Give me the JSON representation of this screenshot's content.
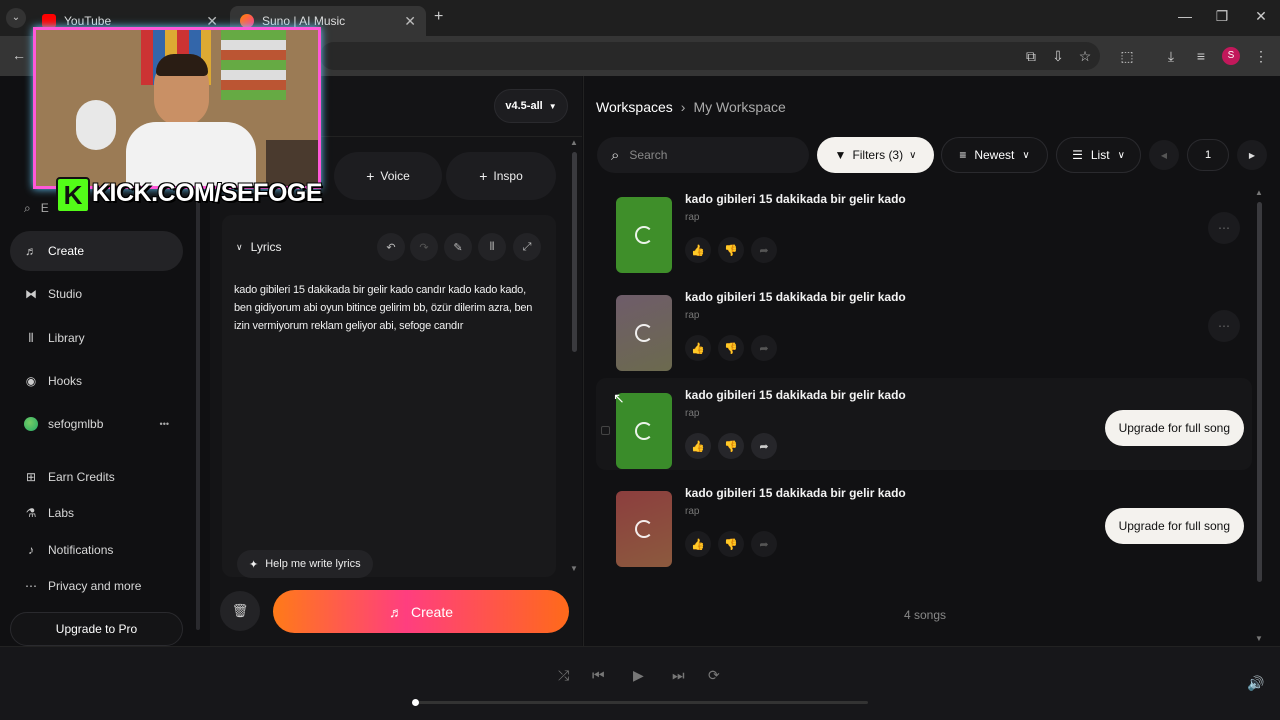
{
  "browser": {
    "tabs": [
      {
        "title": "YouTube",
        "close": "✕"
      },
      {
        "title": "Suno | AI Music",
        "close": "✕"
      }
    ],
    "new_tab": "+",
    "window_controls": [
      "—",
      "❐",
      "✕"
    ],
    "profile_initial": "S"
  },
  "overlay": {
    "badge_letter": "K",
    "stream_url": "KICK.COM/SEFOGE"
  },
  "sidebar": {
    "search_placeholder": "E",
    "items": [
      {
        "label": "Create",
        "icon": "music-note-icon",
        "active": true
      },
      {
        "label": "Studio",
        "icon": "studio-icon"
      },
      {
        "label": "Library",
        "icon": "library-icon"
      },
      {
        "label": "Hooks",
        "icon": "hooks-icon"
      },
      {
        "label": "sefogmlbb",
        "icon": "avatar-icon",
        "more": "•••"
      },
      {
        "label": "Earn Credits",
        "icon": "gift-icon"
      },
      {
        "label": "Labs",
        "icon": "flask-icon"
      },
      {
        "label": "Notifications",
        "icon": "bell-icon"
      },
      {
        "label": "Privacy and more",
        "icon": "more-icon"
      }
    ],
    "upgrade": "Upgrade to Pro"
  },
  "create": {
    "model": "v4.5-all",
    "voice": "Voice",
    "inspo": "Inspo",
    "lyrics_label": "Lyrics",
    "lyrics_text": "kado gibileri 15 dakikada bir gelir kado candır kado kado kado, ben gidiyorum abi oyun bitince gelirim bb, özür dilerim azra, ben izin vermiyorum reklam geliyor abi, sefoge candır",
    "help": "Help me write lyrics",
    "create_button": "Create"
  },
  "workspace": {
    "breadcrumb_root": "Workspaces",
    "breadcrumb_sep": "›",
    "breadcrumb_current": "My Workspace",
    "search_placeholder": "Search",
    "filters": "Filters (3)",
    "sort": "Newest",
    "view": "List",
    "page": "1",
    "count": "4 songs",
    "songs": [
      {
        "title": "kado gibileri 15 dakikada bir gelir kado",
        "tag": "rap",
        "color": "#3f8f2a",
        "upgrade": ""
      },
      {
        "title": "kado gibileri 15 dakikada bir gelir kado",
        "tag": "rap",
        "color": "#6e6060",
        "upgrade": ""
      },
      {
        "title": "kado gibileri 15 dakikada bir gelir kado",
        "tag": "rap",
        "color": "#3a8c2a",
        "upgrade": "Upgrade for full song"
      },
      {
        "title": "kado gibileri 15 dakikada bir gelir kado",
        "tag": "rap",
        "color": "#8c4a3e",
        "upgrade": "Upgrade for full song"
      }
    ]
  },
  "player": {
    "progress": 0
  }
}
